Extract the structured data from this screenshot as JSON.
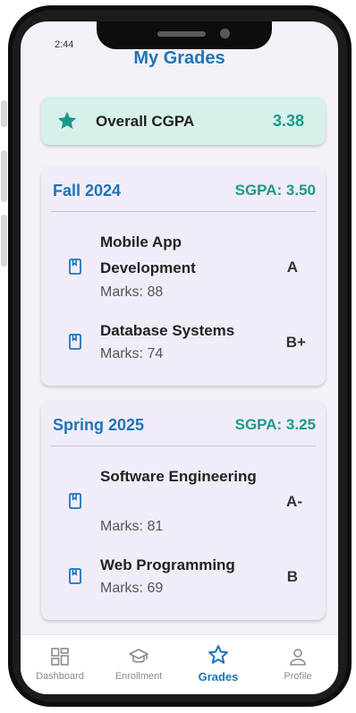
{
  "status_bar": {
    "time": "2:44"
  },
  "header": {
    "title": "My Grades"
  },
  "overall": {
    "label": "Overall CGPA",
    "value": "3.38"
  },
  "semesters": [
    {
      "name": "Fall 2024",
      "sgpa": "SGPA: 3.50",
      "courses": [
        {
          "name": "Mobile App Development",
          "marks": "Marks: 88",
          "grade": "A"
        },
        {
          "name": "Database Systems",
          "marks": "Marks: 74",
          "grade": "B+"
        }
      ]
    },
    {
      "name": "Spring 2025",
      "sgpa": "SGPA: 3.25",
      "courses": [
        {
          "name": "Software Engineering",
          "marks": "Marks: 81",
          "grade": "A-"
        },
        {
          "name": "Web Programming",
          "marks": "Marks: 69",
          "grade": "B"
        }
      ]
    }
  ],
  "nav": {
    "items": [
      {
        "label": "Dashboard",
        "icon": "dashboard-icon"
      },
      {
        "label": "Enrollment",
        "icon": "graduation-cap-icon"
      },
      {
        "label": "Grades",
        "icon": "star-icon",
        "active": true
      },
      {
        "label": "Profile",
        "icon": "person-icon"
      }
    ]
  },
  "colors": {
    "primary": "#1e74b7",
    "accent": "#1a9b8a",
    "card": "#f1ecf7",
    "cgpa_card": "#d7f0ec"
  }
}
